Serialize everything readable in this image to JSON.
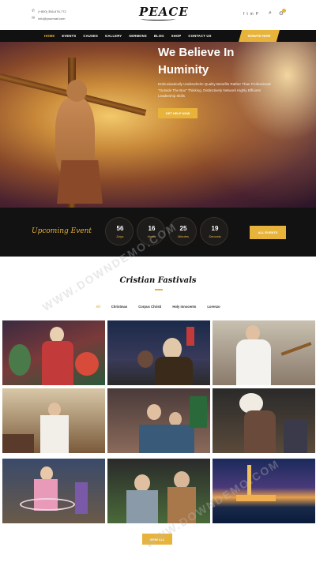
{
  "topbar": {
    "phone": "(+800) 356-676-772",
    "email": "info@yourmail.com",
    "logo": "PEACE",
    "social": [
      "f",
      "t",
      "in",
      "P"
    ]
  },
  "nav": {
    "items": [
      "HOME",
      "EVENTS",
      "CAUSES",
      "GALLERY",
      "SERMONS",
      "BLOG",
      "SHOP",
      "CONTACT US"
    ],
    "donate": "DONATE NOW"
  },
  "hero": {
    "title_line1": "We Believe In",
    "title_line2": "Huminity",
    "text": "Enthusiastically Underwhelm Quality Benefits Rather Than Professional \"Outside The Box\" Thinking. Distinctively Network Highly Efficient Leadership Skills",
    "button": "GET HELP NOW"
  },
  "event": {
    "title": "Upcoming Event",
    "countdown": [
      {
        "value": "56",
        "label": "Days"
      },
      {
        "value": "16",
        "label": "Hours"
      },
      {
        "value": "25",
        "label": "Minutes"
      },
      {
        "value": "19",
        "label": "Seconds"
      }
    ],
    "button": "ALL EVENTS"
  },
  "festivals": {
    "title": "Cristian Fastivals",
    "filters": [
      "All",
      "Christmas",
      "Corpus Christi",
      "Holy Innocents",
      "Lorenzo"
    ],
    "button": "VIEW ALL"
  },
  "watermark": "WWW.DOWNDEMO.COM"
}
